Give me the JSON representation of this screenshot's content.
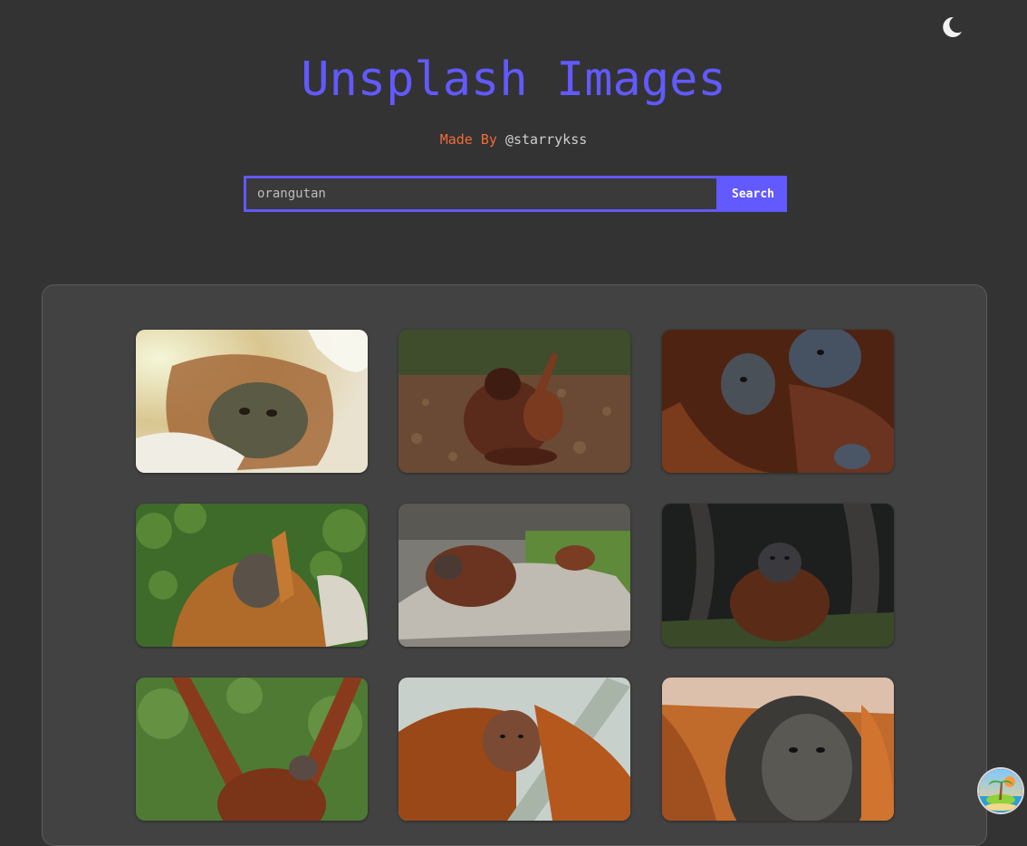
{
  "header": {
    "title": "Unsplash Images",
    "credit_prefix": "Made By",
    "credit_handle": "@starrykss"
  },
  "search": {
    "value": "orangutan",
    "button_label": "Search"
  },
  "icons": {
    "theme_toggle": "moon-icon",
    "floating_button": "beach-island-icon"
  },
  "colors": {
    "accent": "#6259ff",
    "credit": "#f26b3a",
    "background": "#333333",
    "panel": "#424242"
  },
  "gallery": {
    "images": [
      {
        "subject": "orangutan close-up resting in straw"
      },
      {
        "subject": "orangutan mother with baby on forest floor"
      },
      {
        "subject": "two orangutans face to face"
      },
      {
        "subject": "orangutan eating among leaves"
      },
      {
        "subject": "orangutans resting on rock"
      },
      {
        "subject": "orangutan sitting by tree roots"
      },
      {
        "subject": "orangutan hanging from branch with baby"
      },
      {
        "subject": "young orangutan holding rope"
      },
      {
        "subject": "adult male orangutan with cheek pads"
      }
    ]
  }
}
